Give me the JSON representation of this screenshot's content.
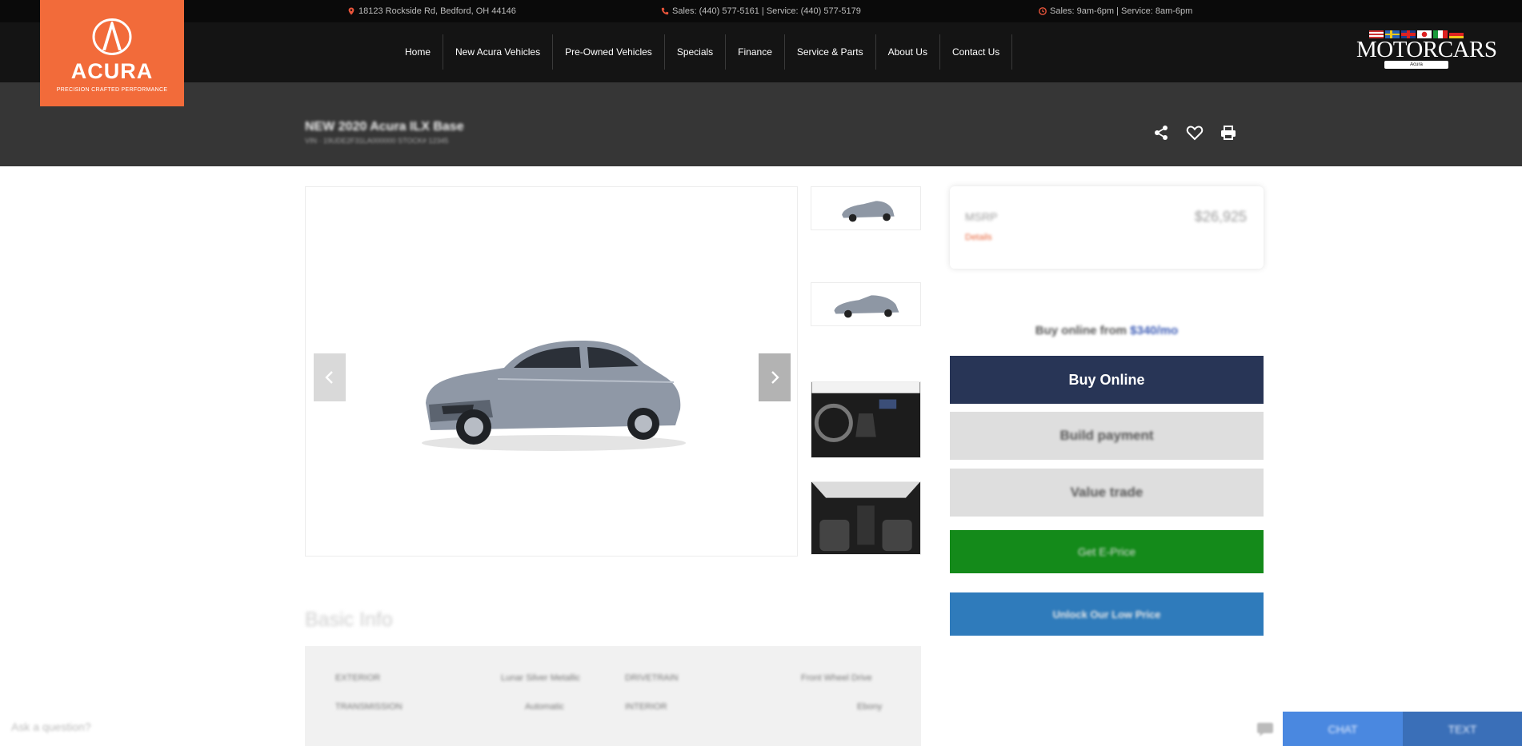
{
  "topbar": {
    "address": "18123 Rockside Rd, Bedford, OH 44146",
    "phones": "Sales: (440) 577-5161 | Service: (440) 577-5179",
    "hours": "Sales: 9am-6pm | Service: 8am-6pm"
  },
  "logo": {
    "brand": "ACURA",
    "tagline": "PRECISION CRAFTED PERFORMANCE"
  },
  "nav": {
    "items": [
      "Home",
      "New Acura Vehicles",
      "Pre-Owned Vehicles",
      "Specials",
      "Finance",
      "Service & Parts",
      "About Us",
      "Contact Us"
    ]
  },
  "dealer": {
    "name": "MOTORCARS",
    "sub": "Acura"
  },
  "vehicle": {
    "title": "NEW 2020 Acura ILX Base",
    "subtitle": "VIN · 19UDE2F31LA000000    STOCK# 12345"
  },
  "pricing": {
    "label": "MSRP",
    "value": "$26,925",
    "details_label": "Details",
    "buy_from_prefix": "Buy online from",
    "buy_from_amount": "$340/mo"
  },
  "actions": {
    "buy_online": "Buy Online",
    "build_payment": "Build payment",
    "value_trade": "Value trade",
    "eprice": "Get E-Price",
    "unlock": "Unlock Our Low Price"
  },
  "basic_info": {
    "title": "Basic Info",
    "rows": [
      {
        "label": "EXTERIOR",
        "value": "Lunar Silver Metallic",
        "label2": "DRIVETRAIN",
        "value2": "Front Wheel Drive"
      },
      {
        "label": "TRANSMISSION",
        "value": "Automatic",
        "label2": "INTERIOR",
        "value2": "Ebony"
      }
    ]
  },
  "chat": {
    "prompt": "Ask a question?",
    "chat_label": "CHAT",
    "text_label": "TEXT"
  },
  "colors": {
    "brand_orange": "#f26b3a",
    "buy_navy": "#283556",
    "eprice_green": "#148a1a",
    "unlock_blue": "#2f7bbb"
  }
}
